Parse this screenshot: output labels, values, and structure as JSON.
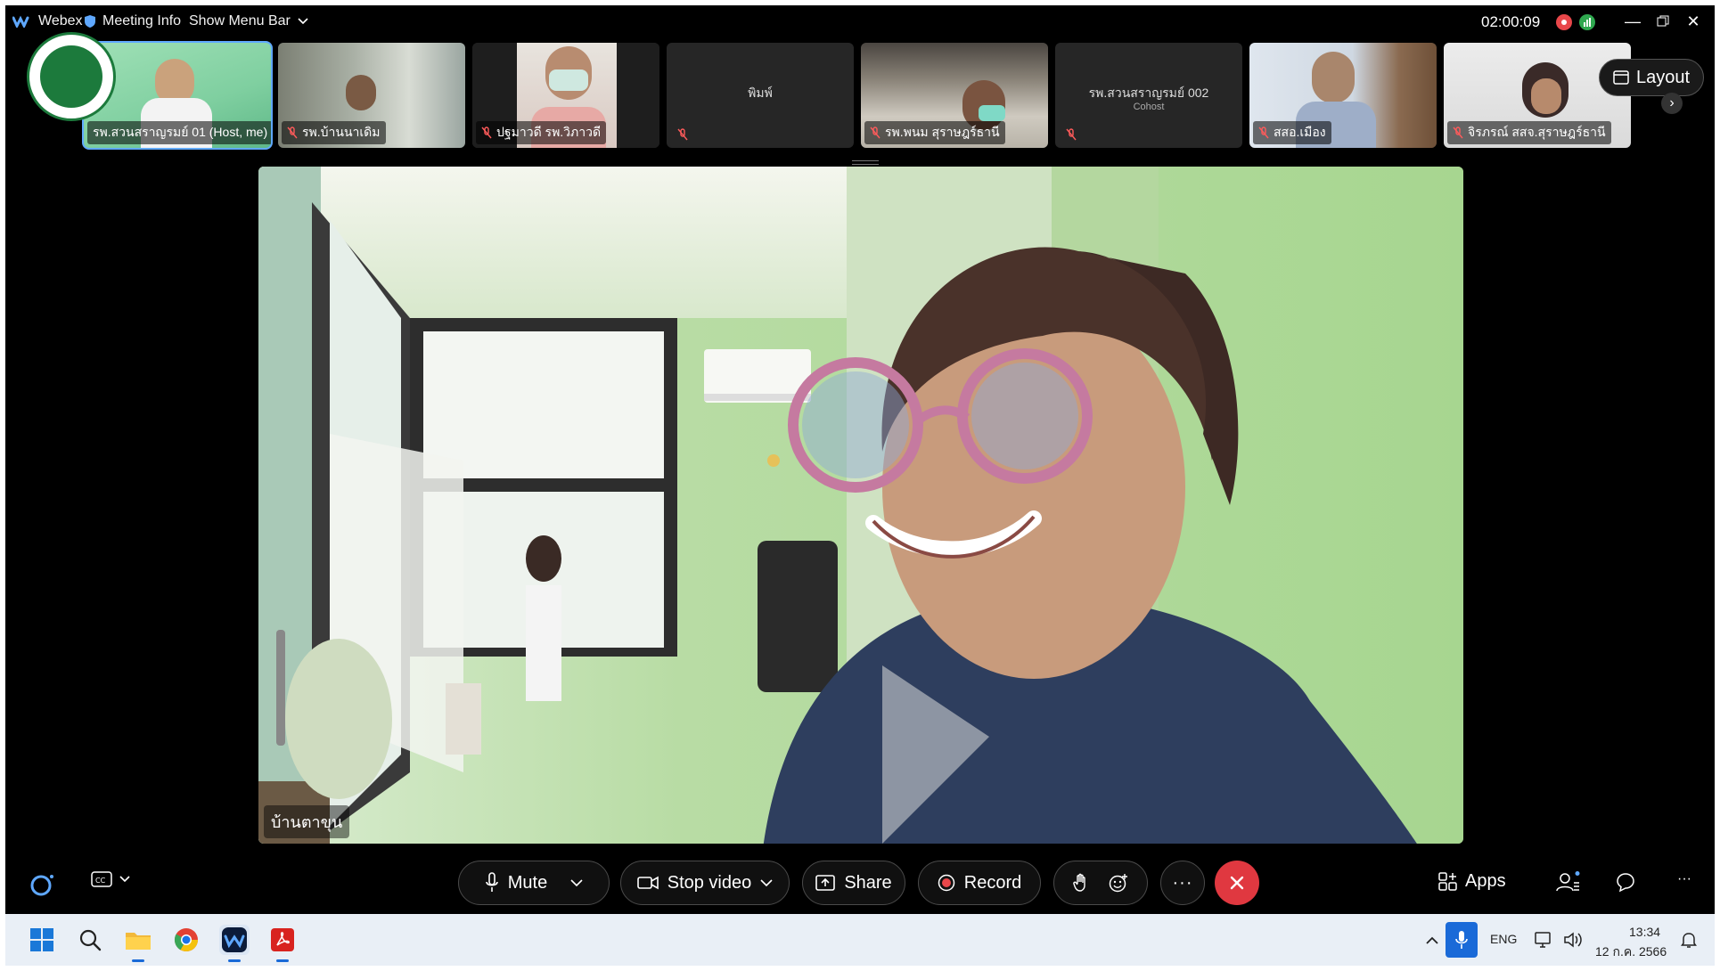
{
  "topbar": {
    "app_name": "Webex",
    "meeting_info": "Meeting Info",
    "show_menu_bar": "Show Menu Bar",
    "timer": "02:00:09"
  },
  "participants": [
    {
      "name": "รพ.สวนสราญรมย์ 01 (Host, me)",
      "muted": false
    },
    {
      "name": "รพ.บ้านนาเดิม",
      "muted": true
    },
    {
      "name": "ปฐมาวดี รพ.วิภาวดี",
      "muted": true
    },
    {
      "name": "พิมพ์",
      "muted": true
    },
    {
      "name": "รพ.พนม สุราษฎร์ธานี",
      "muted": true
    },
    {
      "name": "รพ.สวนสราญรมย์ 002",
      "subtitle": "Cohost",
      "muted": true
    },
    {
      "name": "สสอ.เมือง",
      "muted": true
    },
    {
      "name": "จิรภรณ์ สสจ.สุราษฎร์ธานี",
      "muted": true
    }
  ],
  "layout_label": "Layout",
  "active_speaker": {
    "name": "บ้านตาขุน"
  },
  "controls": {
    "mute": "Mute",
    "stop_video": "Stop video",
    "share": "Share",
    "record": "Record",
    "apps": "Apps"
  },
  "taskbar": {
    "lang": "ENG",
    "time": "13:34",
    "date": "12 ก.ค. 2566"
  },
  "colors": {
    "accent": "#5fa8ff",
    "end_call": "#e03840",
    "record_red": "#e8474a"
  }
}
